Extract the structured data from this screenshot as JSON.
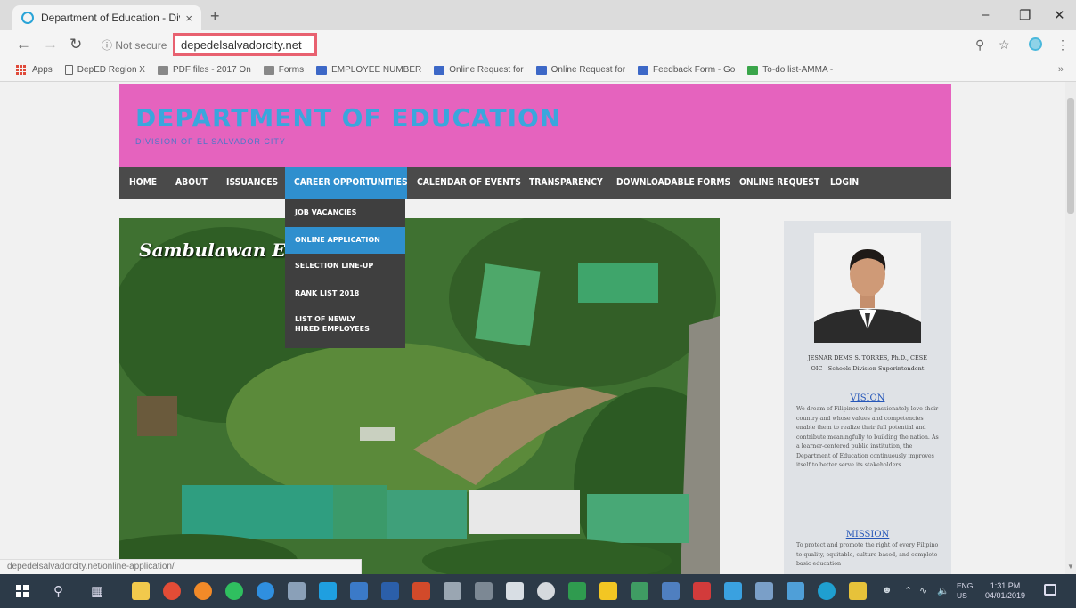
{
  "browser": {
    "tab_title": "Department of Education - Div",
    "tab_close": "×",
    "new_tab": "+",
    "url": "depedelsalvadorcity.net",
    "security": "Not secure",
    "status_url": "depedelsalvadorcity.net/online-application/",
    "bookmarks": [
      {
        "label": "Apps",
        "icon": "apps-icon"
      },
      {
        "label": "DepED Region X",
        "icon": "doc-icon"
      },
      {
        "label": "PDF files - 2017 On",
        "icon": "pdf-icon"
      },
      {
        "label": "Forms",
        "icon": "pdf-icon"
      },
      {
        "label": "EMPLOYEE NUMBER",
        "icon": "sheets-icon"
      },
      {
        "label": "Online Request for",
        "icon": "sheets-icon"
      },
      {
        "label": "Online Request for",
        "icon": "sheets-icon"
      },
      {
        "label": "Feedback Form - Go",
        "icon": "sheets-icon"
      },
      {
        "label": "To-do list-AMMA -",
        "icon": "green-sheet-icon"
      }
    ],
    "bookmarks_more": "»"
  },
  "site": {
    "title": "DEPARTMENT OF EDUCATION",
    "subtitle": "DIVISION OF EL SALVADOR CITY",
    "nav": [
      "HOME",
      "ABOUT",
      "ISSUANCES",
      "CAREER OPPORTUNITIES",
      "CALENDAR OF EVENTS",
      "TRANSPARENCY",
      "DOWNLOADABLE FORMS",
      "ONLINE REQUEST",
      "LOGIN"
    ],
    "active_nav": "CAREER OPPORTUNITIES",
    "dropdown": [
      "JOB VACANCIES",
      "ONLINE APPLICATION",
      "SELECTION LINE-UP",
      "RANK LIST 2018",
      "LIST OF NEWLY HIRED EMPLOYEES"
    ],
    "dropdown_highlight": "ONLINE APPLICATION",
    "slider_caption": "Sambulawan Elem",
    "official_name": "JESNAR DEMS S. TORRES, Ph.D., CESE",
    "official_role": "OIC - Schools Division Superintendent",
    "vision_heading": "VISION",
    "vision_text": "We dream of Filipinos who passionately love their country and whose values and competencies enable them to realize their full potential and contribute meaningfully to building the nation. As a learner-centered public institution, the Department of Education continuously improves itself to better serve its stakeholders.",
    "mission_heading": "MISSION",
    "mission_text": "To protect and promote the right of every Filipino to quality, equitable, culture-based, and complete basic education"
  },
  "taskbar": {
    "lang_top": "ENG",
    "lang_bottom": "US",
    "time": "1:31 PM",
    "date": "04/01/2019"
  },
  "colors": {
    "header_bg": "#e563be",
    "title": "#3aa6dd",
    "nav_bg": "#4a4a4a",
    "nav_active": "#2f8fce",
    "url_highlight": "#e86170"
  }
}
